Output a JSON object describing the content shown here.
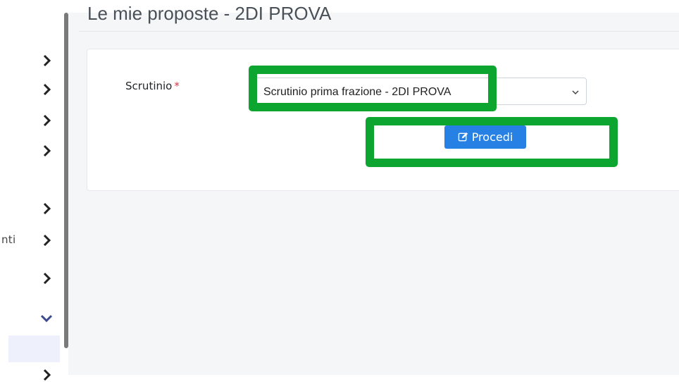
{
  "header": {
    "title": "Le mie proposte - 2DI PROVA"
  },
  "sidebar": {
    "partial_label": "nti",
    "items": [
      {
        "icon": "chevron-right-icon"
      },
      {
        "icon": "chevron-right-icon"
      },
      {
        "icon": "chevron-right-icon"
      },
      {
        "icon": "chevron-right-icon"
      },
      {
        "icon": "chevron-right-icon"
      },
      {
        "icon": "chevron-right-icon"
      },
      {
        "icon": "chevron-right-icon"
      },
      {
        "icon": "chevron-down-icon"
      },
      {
        "icon": "chevron-right-icon"
      }
    ]
  },
  "form": {
    "scrutinio_label": "Scrutinio",
    "required_mark": "*",
    "scrutinio_value": "Scrutinio prima frazione - 2DI PROVA",
    "submit_label": "Procedi",
    "submit_icon": "edit-icon"
  },
  "colors": {
    "primary": "#2780e3",
    "highlight": "#0ca530",
    "required": "#dc3545"
  }
}
